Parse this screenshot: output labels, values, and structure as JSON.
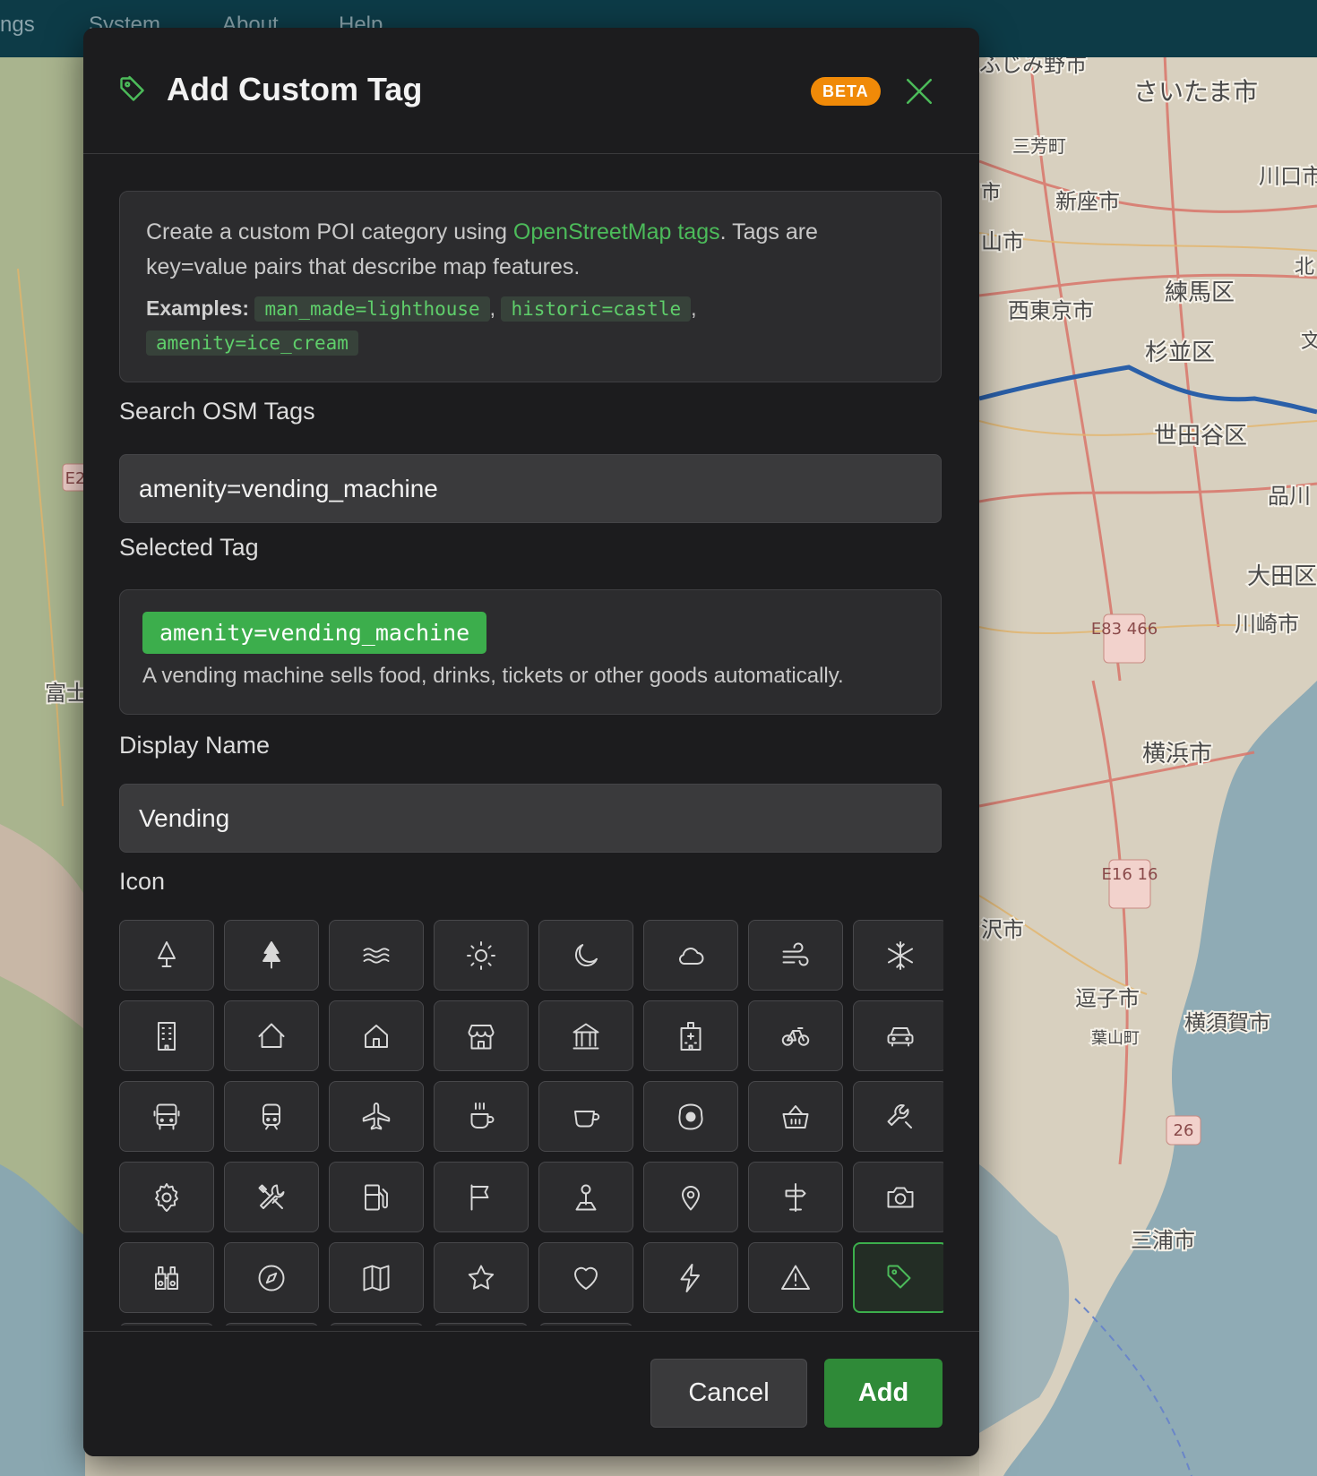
{
  "menubar": {
    "items": [
      "ngs",
      "System",
      "About",
      "Help"
    ]
  },
  "map": {
    "labels": [
      "ふじみ野市",
      "さいたま市",
      "三芳町",
      "新座市",
      "川口市",
      "西東京市",
      "練馬区",
      "杉並区",
      "世田谷区",
      "品川",
      "大田区",
      "川崎市",
      "横浜市",
      "逗子市",
      "横須賀市",
      "葉山町",
      "三浦市",
      "富士",
      "沢市",
      "山市",
      "北",
      "文",
      "市"
    ],
    "road_shields": [
      "E83 466",
      "E16 16",
      "26",
      "E2"
    ]
  },
  "dialog": {
    "title": "Add Custom Tag",
    "title_icon": "tag-icon",
    "badge": "BETA",
    "close_icon": "close-icon",
    "accent_color": "#4cbb5a",
    "badge_color": "#f08a08",
    "info": {
      "text_before": "Create a custom POI category using ",
      "link_text": "OpenStreetMap tags",
      "text_after": ". Tags are key=value pairs that describe map features.",
      "examples_label": "Examples:",
      "examples": [
        "man_made=lighthouse",
        "historic=castle",
        "amenity=ice_cream"
      ],
      "separator": ","
    },
    "search": {
      "label": "Search OSM Tags",
      "value": "amenity=vending_machine"
    },
    "selected": {
      "label": "Selected Tag",
      "tag": "amenity=vending_machine",
      "description": "A vending machine sells food, drinks, tickets or other goods automatically."
    },
    "display_name": {
      "label": "Display Name",
      "value": "Vending"
    },
    "icon_section": {
      "label": "Icon",
      "selected": "tag-icon",
      "icons": [
        "tree-outline-icon",
        "tree-filled-icon",
        "water-waves-icon",
        "sun-icon",
        "moon-icon",
        "cloud-icon",
        "wind-icon",
        "snowflake-icon",
        "building-icon",
        "house-icon",
        "home-icon",
        "store-icon",
        "bank-icon",
        "hospital-icon",
        "bicycle-icon",
        "car-icon",
        "bus-icon",
        "train-icon",
        "airplane-icon",
        "hot-coffee-icon",
        "cup-icon",
        "fried-egg-icon",
        "basket-icon",
        "wrench-icon",
        "gear-icon",
        "tools-icon",
        "fuel-pump-icon",
        "flag-icon",
        "person-pin-icon",
        "map-pin-icon",
        "signpost-icon",
        "camera-icon",
        "binoculars-icon",
        "compass-icon",
        "map-icon",
        "star-icon",
        "heart-icon",
        "lightning-icon",
        "warning-icon",
        "tag-icon"
      ]
    },
    "buttons": {
      "cancel": "Cancel",
      "add": "Add"
    }
  }
}
